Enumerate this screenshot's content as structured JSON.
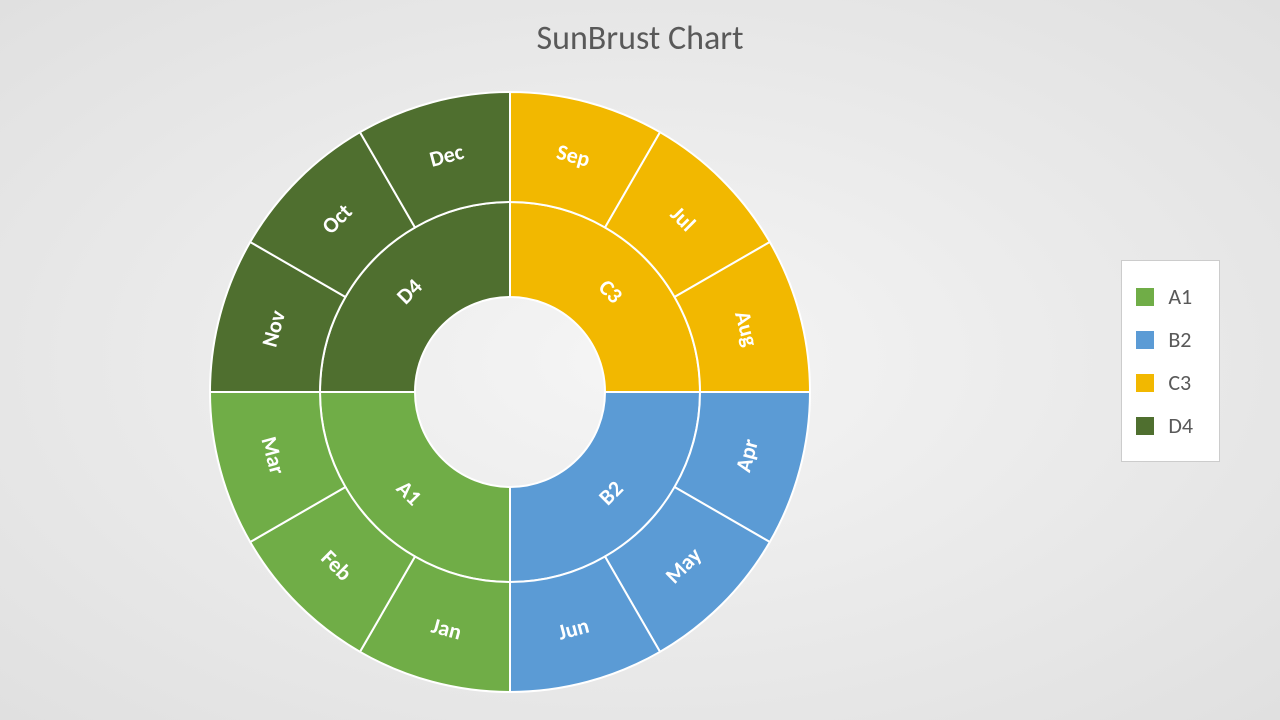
{
  "chart_data": {
    "type": "sunburst",
    "title": "SunBrust Chart",
    "categories": [
      {
        "name": "A1",
        "color": "#70AD47",
        "children": [
          {
            "name": "Jan",
            "value": 1
          },
          {
            "name": "Feb",
            "value": 1
          },
          {
            "name": "Mar",
            "value": 1
          }
        ]
      },
      {
        "name": "B2",
        "color": "#5B9BD5",
        "children": [
          {
            "name": "Apr",
            "value": 1
          },
          {
            "name": "May",
            "value": 1
          },
          {
            "name": "Jun",
            "value": 1
          }
        ]
      },
      {
        "name": "C3",
        "color": "#F2B800",
        "children": [
          {
            "name": "Sep",
            "value": 1
          },
          {
            "name": "Jul",
            "value": 1
          },
          {
            "name": "Aug",
            "value": 1
          }
        ]
      },
      {
        "name": "D4",
        "color": "#4F6F2F",
        "children": [
          {
            "name": "Nov",
            "value": 1
          },
          {
            "name": "Oct",
            "value": 1
          },
          {
            "name": "Dec",
            "value": 1
          }
        ]
      }
    ],
    "legend": [
      {
        "name": "A1",
        "color": "#70AD47"
      },
      {
        "name": "B2",
        "color": "#5B9BD5"
      },
      {
        "name": "C3",
        "color": "#F2B800"
      },
      {
        "name": "D4",
        "color": "#4F6F2F"
      }
    ]
  }
}
